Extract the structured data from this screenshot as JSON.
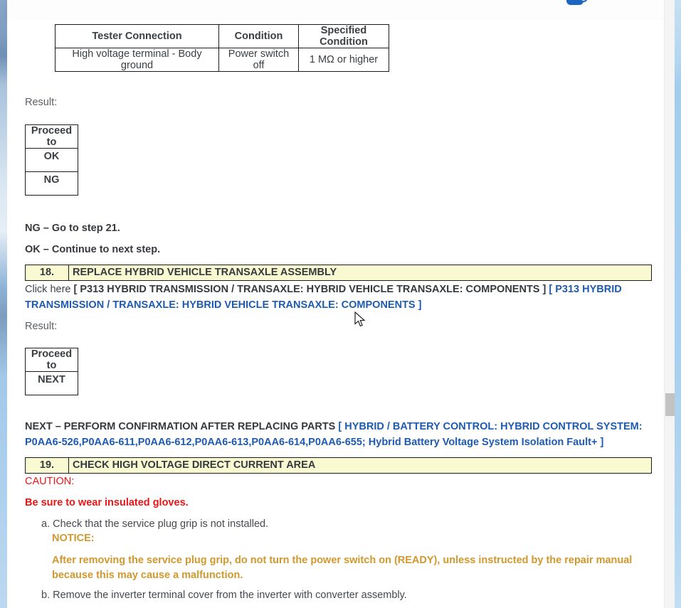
{
  "toolbar": {
    "icon": "announcement-icon"
  },
  "spec_table": {
    "headers": [
      "Tester Connection",
      "Condition",
      "Specified Condition"
    ],
    "row": {
      "tester_connection": "High voltage terminal - Body ground",
      "condition": "Power switch off",
      "specified_condition": "1 MΩ or higher"
    }
  },
  "result_label_1": "Result:",
  "proceed_table_1": {
    "header": "Proceed to",
    "rows": [
      "OK",
      "NG"
    ]
  },
  "ng_line": "NG – Go to step 21.",
  "ok_line": "OK – Continue to next step.",
  "step18": {
    "number": "18.",
    "title": "REPLACE HYBRID VEHICLE TRANSAXLE ASSEMBLY"
  },
  "click_here": {
    "prefix": "Click here ",
    "bold_ref": "[ P313 HYBRID TRANSMISSION / TRANSAXLE: HYBRID VEHICLE TRANSAXLE: COMPONENTS ] ",
    "link": "[ P313 HYBRID TRANSMISSION / TRANSAXLE: HYBRID VEHICLE TRANSAXLE: COMPONENTS ]"
  },
  "result_label_2": "Result:",
  "proceed_table_2": {
    "header": "Proceed to",
    "rows": [
      "NEXT"
    ]
  },
  "next_confirm": {
    "prefix": "NEXT – PERFORM CONFIRMATION AFTER REPLACING PARTS ",
    "link": "[ HYBRID / BATTERY CONTROL: HYBRID CONTROL SYSTEM: P0AA6-526,P0AA6-611,P0AA6-612,P0AA6-613,P0AA6-614,P0AA6-655; Hybrid Battery Voltage System Isolation Fault+ ]"
  },
  "step19": {
    "number": "19.",
    "title": "CHECK HIGH VOLTAGE DIRECT CURRENT AREA"
  },
  "caution_label": "CAUTION:",
  "caution_text": "Be sure to wear insulated gloves.",
  "substeps": [
    {
      "marker": "a.",
      "text": "Check that the service plug grip is not installed."
    },
    {
      "marker": "b.",
      "text": "Remove the inverter terminal cover from the inverter with converter assembly."
    }
  ],
  "notice_label": "NOTICE:",
  "notice_text": "After removing the service plug grip, do not turn the power switch on (READY), unless instructed by the repair manual because this may cause a malfunction.",
  "colors": {
    "step_header_bg": "#fafad2",
    "link_blue": "#1e5bb0",
    "caution_red": "#ee1414",
    "notice_orange": "#d1982e",
    "edge_blue": "#a9d0ee",
    "scroll_thumb": "#c2c2c2"
  }
}
